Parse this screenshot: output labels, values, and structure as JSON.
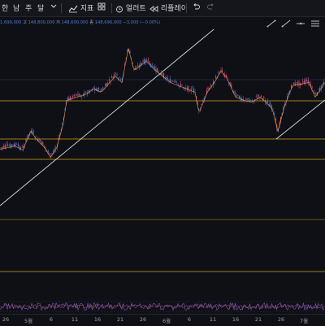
{
  "toolbar": {
    "period_items": [
      "한",
      "남",
      "주",
      "달"
    ],
    "indicator_label": "지표",
    "alert_label": "얼러트",
    "replay_label": "리플레이"
  },
  "infobar": {
    "close_prefix": "1,699,000",
    "high_label": "고",
    "high_value": "148,800,000",
    "low_label": "저",
    "low_value": "148,600,000",
    "close_label": "종",
    "close_value": "148,696,000",
    "change_value": "−3,000 (−0.00%)"
  },
  "xaxis": {
    "labels": [
      "26",
      "5월",
      "6",
      "11",
      "16",
      "21",
      "26",
      "6월",
      "6",
      "11",
      "16",
      "21",
      "26",
      "7월"
    ]
  },
  "colors": {
    "background": "#0f1015",
    "horizontal_line": "#d4a017",
    "trend_line": "#d9d9d9",
    "up": "#e0507a",
    "down": "#4f7bd9"
  }
}
